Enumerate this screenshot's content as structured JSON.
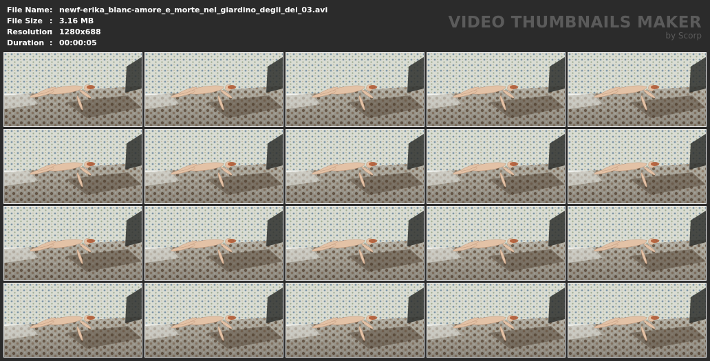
{
  "info": {
    "file_name_label": "File Name",
    "file_name_value": "newf-erika_blanc-amore_e_morte_nel_giardino_degli_dei_03.avi",
    "file_size_label": "File Size",
    "file_size_value": "3.16 MB",
    "resolution_label": "Resolution",
    "resolution_value": "1280x688",
    "duration_label": "Duration",
    "duration_value": "00:00:05",
    "separator": ":"
  },
  "brand": {
    "title": "VIDEO THUMBNAILS MAKER",
    "subtitle": "by Scorp"
  },
  "thumbnails": {
    "rows": 4,
    "columns": 5,
    "count": 20
  },
  "colors": {
    "background": "#2b2b2b",
    "info_text": "#ffffff",
    "brand_text": "#5b5b5b",
    "thumb_border": "#e8e8e8"
  }
}
